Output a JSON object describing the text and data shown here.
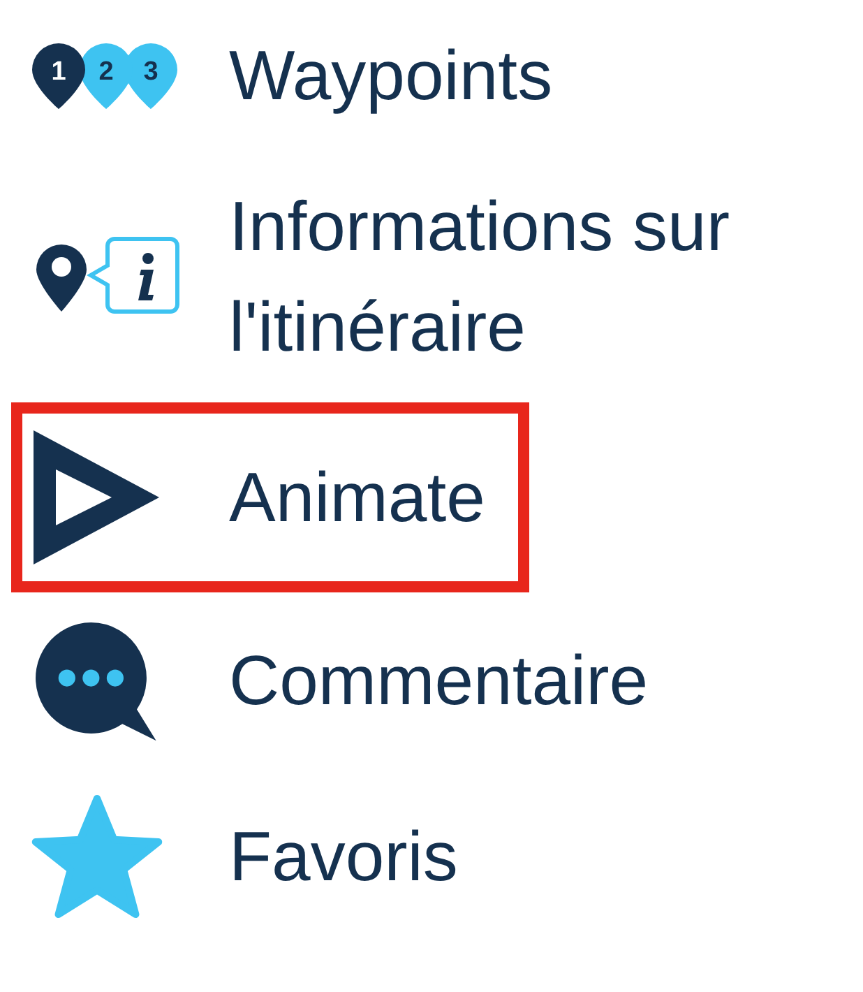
{
  "menu_items": [
    {
      "kind": "waypoints",
      "label": "Waypoints",
      "markers": [
        "1",
        "2",
        "3"
      ],
      "highlighted": false
    },
    {
      "kind": "route-info",
      "label": "Informations sur l'itinéraire",
      "highlighted": false
    },
    {
      "kind": "animate",
      "label": "Animate",
      "highlighted": true
    },
    {
      "kind": "comment",
      "label": "Commentaire",
      "highlighted": false
    },
    {
      "kind": "favorite",
      "label": "Favoris",
      "highlighted": false
    }
  ]
}
